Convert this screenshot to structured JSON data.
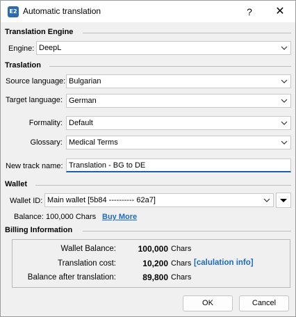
{
  "window": {
    "title": "Automatic translation",
    "help_label": "?",
    "close_label": "✕",
    "icon_text": "E2"
  },
  "engine_section": {
    "heading": "Translation Engine",
    "engine_label": "Engine:",
    "engine_value": "DeepL"
  },
  "translation_section": {
    "heading": "Traslation",
    "source_label": "Source language:",
    "source_value": "Bulgarian",
    "target_label": "Target language:",
    "target_value": "German",
    "formality_label": "Formality:",
    "formality_value": "Default",
    "glossary_label": "Glossary:",
    "glossary_value": "Medical Terms",
    "track_label": "New track name:",
    "track_value": "Translation - BG to DE"
  },
  "wallet_section": {
    "heading": "Wallet",
    "wallet_id_label": "Wallet ID:",
    "wallet_id_value": "Main wallet [5b84 ---------- 62a7]",
    "balance_label": "Balance:",
    "balance_value": "100,000 Chars",
    "buy_more_label": "Buy More"
  },
  "billing_section": {
    "heading": "Billing Information",
    "wallet_balance_label": "Wallet Balance:",
    "wallet_balance_value": "100,000",
    "wallet_balance_unit": "Chars",
    "cost_label": "Translation cost:",
    "cost_value": "10,200",
    "cost_unit": "Chars",
    "calc_info_label": "[calulation info]",
    "after_label": "Balance after translation:",
    "after_value": "89,800",
    "after_unit": "Chars"
  },
  "buttons": {
    "ok": "OK",
    "cancel": "Cancel"
  }
}
